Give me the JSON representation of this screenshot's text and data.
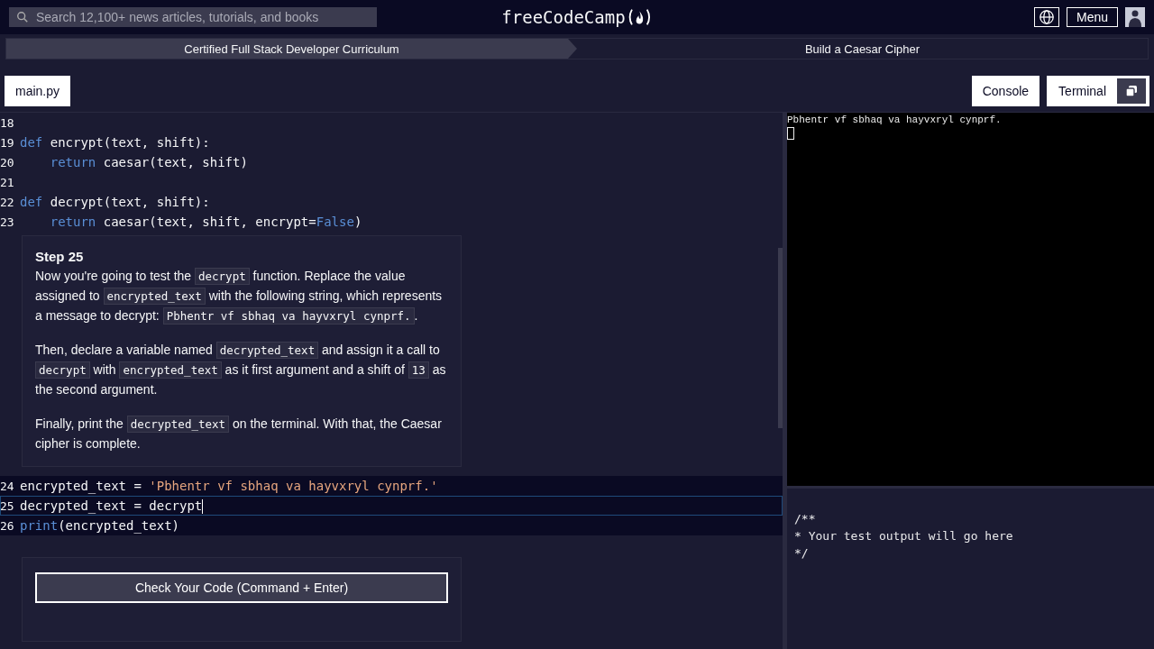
{
  "nav": {
    "search_placeholder": "Search 12,100+ news articles, tutorials, and books",
    "logo": "freeCodeCamp",
    "menu": "Menu"
  },
  "breadcrumbs": [
    {
      "label": "Certified Full Stack Developer Curriculum"
    },
    {
      "label": "Build a Caesar Cipher"
    }
  ],
  "file_tabs": [
    {
      "label": "main.py",
      "selected": true
    }
  ],
  "panel_tabs": [
    {
      "label": "Console"
    },
    {
      "label": "Terminal"
    }
  ],
  "code_top": [
    {
      "number": "18"
    },
    {
      "number": "19",
      "tokens": [
        {
          "kind": "keyword",
          "text": "def"
        },
        {
          "kind": "plain",
          "text": " encrypt(text, shift):"
        }
      ]
    },
    {
      "number": "20",
      "indented": true,
      "tokens": [
        {
          "kind": "keyword",
          "text": "return"
        },
        {
          "kind": "plain",
          "text": " caesar(text, shift)"
        }
      ]
    },
    {
      "number": "21"
    },
    {
      "number": "22",
      "tokens": [
        {
          "kind": "keyword",
          "text": "def"
        },
        {
          "kind": "plain",
          "text": " decrypt(text, shift):"
        }
      ]
    },
    {
      "number": "23",
      "indented": true,
      "tokens": [
        {
          "kind": "keyword",
          "text": "return"
        },
        {
          "kind": "plain",
          "text": " caesar(text, shift, encrypt="
        },
        {
          "kind": "bool",
          "text": "False"
        },
        {
          "kind": "plain",
          "text": ")"
        }
      ]
    }
  ],
  "step": {
    "title": "Step 25",
    "paragraphs": [
      [
        {
          "kind": "text",
          "text": "Now you're going to test the "
        },
        {
          "kind": "code",
          "text": "decrypt"
        },
        {
          "kind": "text",
          "text": " function. Replace the value assigned to "
        },
        {
          "kind": "code",
          "text": "encrypted_text"
        },
        {
          "kind": "text",
          "text": " with the following string, which represents a message to decrypt: "
        },
        {
          "kind": "code",
          "text": "Pbhentr vf sbhaq va hayvxryl cynprf."
        },
        {
          "kind": "text",
          "text": "."
        }
      ],
      [
        {
          "kind": "text",
          "text": "Then, declare a variable named "
        },
        {
          "kind": "code",
          "text": "decrypted_text"
        },
        {
          "kind": "text",
          "text": " and assign it a call to "
        },
        {
          "kind": "code",
          "text": "decrypt"
        },
        {
          "kind": "text",
          "text": " with "
        },
        {
          "kind": "code",
          "text": "encrypted_text"
        },
        {
          "kind": "text",
          "text": " as it first argument and a shift of "
        },
        {
          "kind": "code",
          "text": "13"
        },
        {
          "kind": "text",
          "text": " as the second argument."
        }
      ],
      [
        {
          "kind": "text",
          "text": "Finally, print the "
        },
        {
          "kind": "code",
          "text": "decrypted_text"
        },
        {
          "kind": "text",
          "text": " on the terminal. With that, the Caesar cipher is complete."
        }
      ]
    ]
  },
  "code_bottom": [
    {
      "number": "24",
      "active": false,
      "tokens": [
        {
          "kind": "plain",
          "text": "encrypted_text = "
        },
        {
          "kind": "string",
          "text": "'Pbhentr vf sbhaq va hayvxryl cynprf.'"
        }
      ]
    },
    {
      "number": "25",
      "active": true,
      "tokens": [
        {
          "kind": "plain",
          "text": "decrypted_text = decrypt"
        }
      ]
    },
    {
      "number": "26",
      "active": false,
      "tokens": [
        {
          "kind": "keyword",
          "text": "print"
        },
        {
          "kind": "plain",
          "text": "(encrypted_text)"
        }
      ]
    }
  ],
  "check_button": "Check Your Code (Command + Enter)",
  "terminal": {
    "lines": [
      "Pbhentr vf sbhaq va hayvxryl cynprf."
    ]
  },
  "test_output": [
    "/**",
    "* Your test output will go here",
    "*/"
  ]
}
